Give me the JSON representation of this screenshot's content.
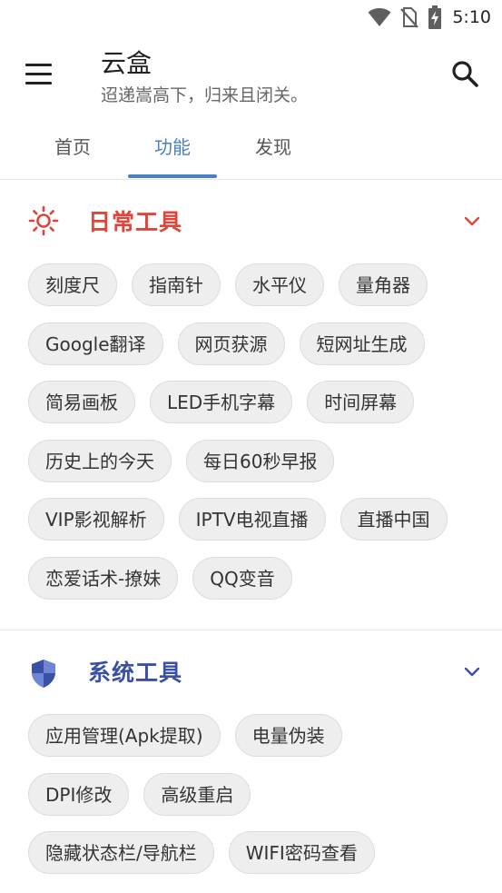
{
  "status_bar": {
    "time": "5:10"
  },
  "app_bar": {
    "title": "云盒",
    "subtitle": "迢递嵩高下，归来且闭关。"
  },
  "tabs": [
    {
      "label": "首页"
    },
    {
      "label": "功能",
      "active": true
    },
    {
      "label": "发现"
    }
  ],
  "sections": [
    {
      "title": "日常工具",
      "icon": "sun-icon",
      "color": "#e0443b",
      "rows": [
        [
          "刻度尺",
          "指南针",
          "水平仪",
          "量角器"
        ],
        [
          "Google翻译",
          "网页获源",
          "短网址生成"
        ],
        [
          "简易画板",
          "LED手机字幕",
          "时间屏幕"
        ],
        [
          "历史上的今天",
          "每日60秒早报"
        ],
        [
          "VIP影视解析",
          "IPTV电视直播",
          "直播中国"
        ],
        [
          "恋爱话术-撩妹",
          "QQ变音"
        ]
      ]
    },
    {
      "title": "系统工具",
      "icon": "shield-icon",
      "color": "#3a4fa6",
      "rows": [
        [
          "应用管理(Apk提取)",
          "电量伪装"
        ],
        [
          "DPI修改",
          "高级重启"
        ],
        [
          "隐藏状态栏/导航栏",
          "WIFI密码查看"
        ]
      ]
    }
  ],
  "colors": {
    "accent": "#4a7fc6",
    "chip_bg": "#eeeeee"
  }
}
